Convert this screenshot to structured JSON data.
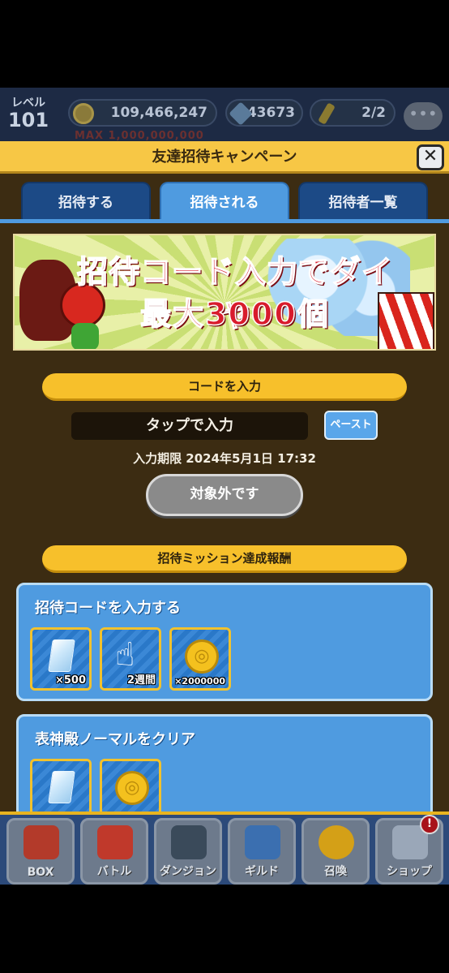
{
  "hud": {
    "level_label": "レベル",
    "level_value": "101",
    "coins": "109,466,247",
    "coins_max": "MAX 1,000,000,000",
    "diamonds": "43673",
    "keys": "2/2",
    "chat_icon": "chat-bubble-icon"
  },
  "modal": {
    "title": "友達招待キャンペーン",
    "close_label": "✕",
    "tabs": [
      {
        "label": "招待する",
        "active": false
      },
      {
        "label": "招待される",
        "active": true
      },
      {
        "label": "招待者一覧",
        "active": false
      }
    ],
    "banner": {
      "line1": "招待コード入力でダイヤ",
      "line2": "最大3000個"
    },
    "code_section": {
      "header": "コードを入力",
      "input_placeholder": "タップで入力",
      "paste_label": "ペースト",
      "deadline": "入力期限 2024年5月1日 17:32",
      "status_button": "対象外です"
    },
    "missions_header": "招待ミッション達成報酬",
    "missions": [
      {
        "title": "招待コードを入力する",
        "rewards": [
          {
            "icon": "diamond-icon",
            "qty": "×500"
          },
          {
            "icon": "tap-hand-icon",
            "qty": "2週間"
          },
          {
            "icon": "coin-icon",
            "qty": "×2000000"
          }
        ]
      },
      {
        "title": "表神殿ノーマルをクリア",
        "rewards": [
          {
            "icon": "diamond-icon",
            "qty": ""
          },
          {
            "icon": "coin-icon",
            "qty": ""
          }
        ]
      }
    ]
  },
  "bottom_nav": [
    {
      "label": "BOX",
      "icon": "treasure-chest-icon",
      "color": "#b33a2a"
    },
    {
      "label": "バトル",
      "icon": "shield-icon",
      "color": "#c0392b"
    },
    {
      "label": "ダンジョン",
      "icon": "dungeon-gate-icon",
      "color": "#3a4a5a"
    },
    {
      "label": "ギルド",
      "icon": "crossed-swords-icon",
      "color": "#3b6fb0"
    },
    {
      "label": "召喚",
      "icon": "summon-circle-icon",
      "color": "#d4a017"
    },
    {
      "label": "ショップ",
      "icon": "crystal-icon",
      "color": "#9aa7b8"
    }
  ],
  "nav_badge": "!"
}
